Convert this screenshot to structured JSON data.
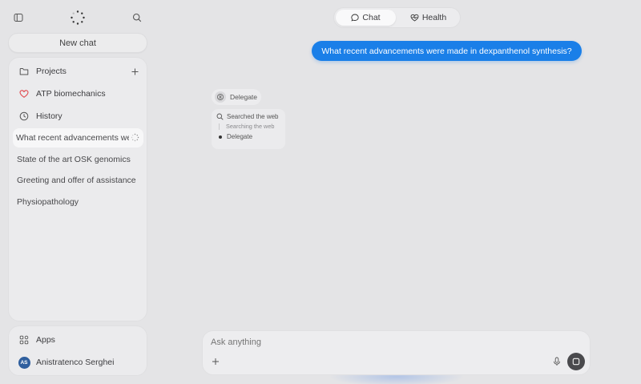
{
  "sidebar": {
    "new_chat": "New chat",
    "projects_label": "Projects",
    "pinned_label": "ATP biomechanics",
    "history_label": "History",
    "chats": [
      "What recent advancements were made in dexpanthenol synthesis?",
      "State of the art OSK genomics",
      "Greeting and offer of assistance",
      "Physiopathology"
    ],
    "apps_label": "Apps",
    "user_initials": "AS",
    "user_name": "Anistratenco Serghei"
  },
  "tabs": {
    "chat": "Chat",
    "health": "Health"
  },
  "conversation": {
    "user_message": "What recent advancements were made in dexpanthenol synthesis?",
    "delegate_chip": "Delegate",
    "steps": {
      "searched": "Searched the web",
      "searching": "Searching the web",
      "delegate": "Delegate"
    }
  },
  "composer": {
    "placeholder": "Ask anything"
  },
  "colors": {
    "accent": "#1a7fe8",
    "background": "#e4e4e6",
    "heart": "#e0474c"
  }
}
